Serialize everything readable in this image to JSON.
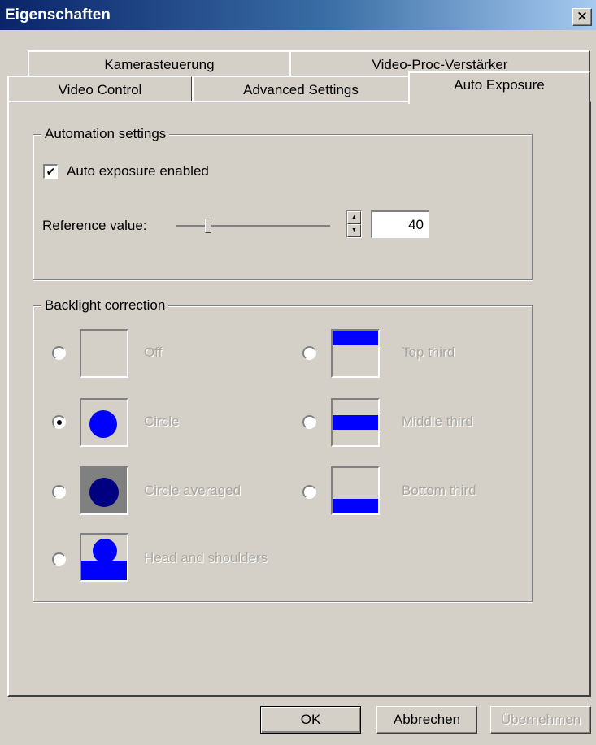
{
  "window": {
    "title": "Eigenschaften",
    "close_glyph": "✕"
  },
  "tabs": {
    "row_back": [
      "Kamerasteuerung",
      "Video-Proc-Verstärker"
    ],
    "row_front": [
      "Video Control",
      "Advanced Settings",
      "Auto Exposure"
    ],
    "active": "Auto Exposure"
  },
  "automation": {
    "legend": "Automation settings",
    "auto_exposure_label": "Auto exposure enabled",
    "auto_exposure_checked": true,
    "check_glyph": "✔",
    "reference_label": "Reference value:",
    "reference_value": "40",
    "slider_level": 0.2
  },
  "backlight": {
    "legend": "Backlight correction",
    "options": [
      {
        "label": "Off",
        "icon": "off-preview-icon",
        "selected": false
      },
      {
        "label": "Circle",
        "icon": "circle-preview-icon",
        "selected": true
      },
      {
        "label": "Circle averaged",
        "icon": "circle-averaged-preview-icon",
        "selected": false
      },
      {
        "label": "Head and shoulders",
        "icon": "head-shoulders-preview-icon",
        "selected": false
      },
      {
        "label": "Top third",
        "icon": "top-third-preview-icon",
        "selected": false
      },
      {
        "label": "Middle third",
        "icon": "middle-third-preview-icon",
        "selected": false
      },
      {
        "label": "Bottom third",
        "icon": "bottom-third-preview-icon",
        "selected": false
      }
    ],
    "colors": {
      "highlight": "#0000ff",
      "averaged_bg": "#808080",
      "averaged_fg": "#000080"
    }
  },
  "buttons": {
    "ok": "OK",
    "cancel": "Abbrechen",
    "apply": "Übernehmen"
  }
}
